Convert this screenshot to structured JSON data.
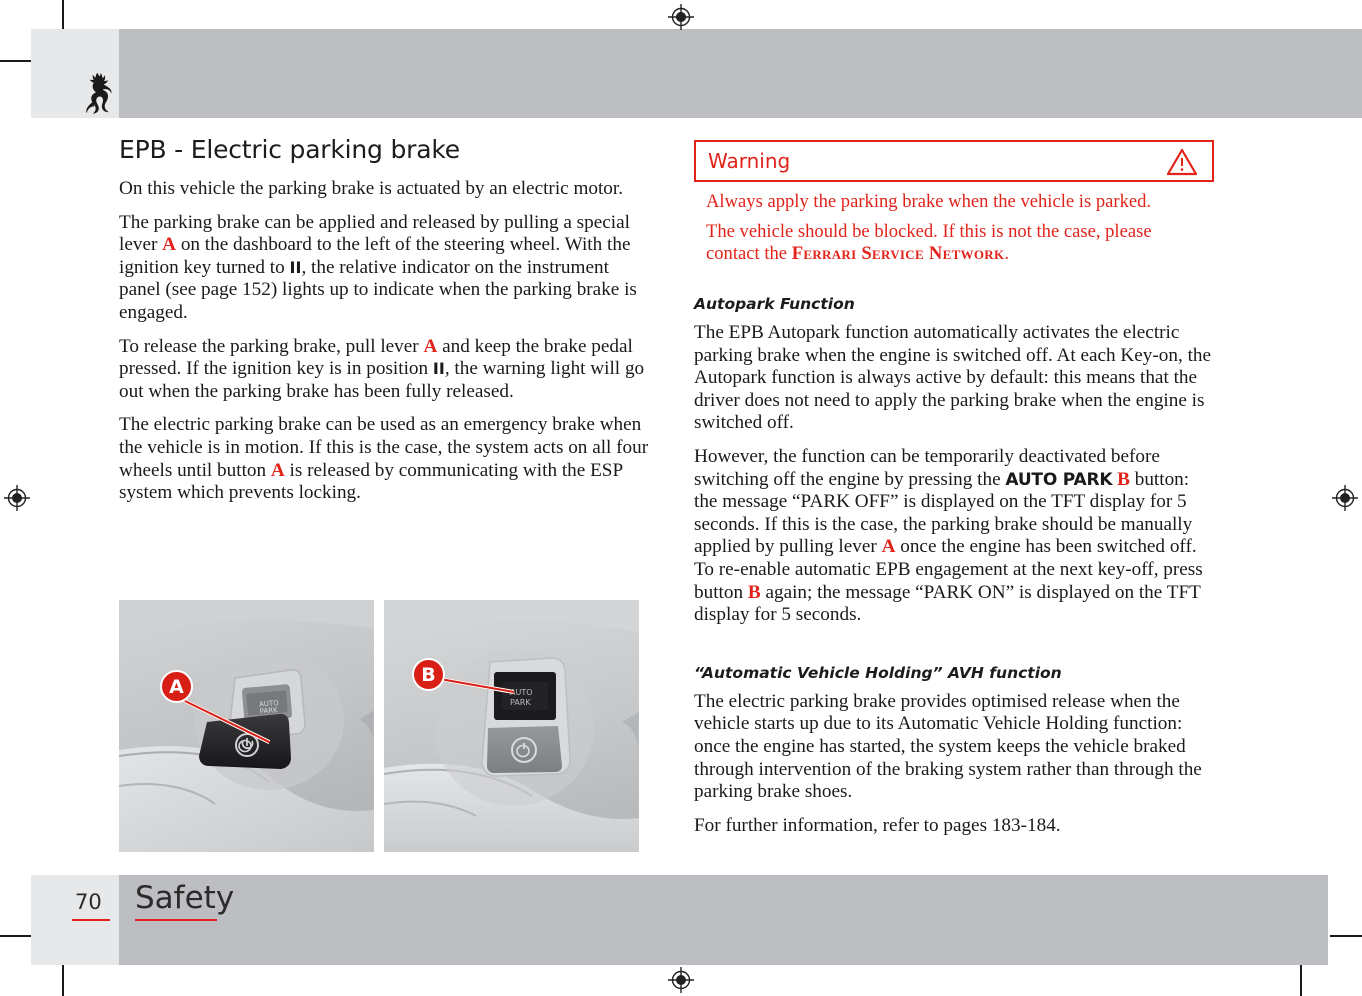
{
  "document": {
    "brand_mark": "ferrari-prancing-horse",
    "page_number": "70",
    "section_name": "Safety"
  },
  "left_column": {
    "title": "EPB - Electric parking brake",
    "paragraphs": [
      {
        "id": "p1",
        "runs": [
          {
            "t": "On this vehicle the parking brake is actuated by an electric motor.",
            "s": "n"
          }
        ]
      },
      {
        "id": "p2",
        "runs": [
          {
            "t": "The parking brake can be applied and released by pulling a special lever ",
            "s": "n"
          },
          {
            "t": "A",
            "s": "ref"
          },
          {
            "t": " on the dashboard to the left of the steering wheel. With the ignition key turned to ",
            "s": "n"
          },
          {
            "t": "II",
            "s": "key"
          },
          {
            "t": ", the relative indicator on the instrument panel (see page 152) lights up to indicate when the parking brake is engaged.",
            "s": "n"
          }
        ]
      },
      {
        "id": "p3",
        "runs": [
          {
            "t": "To release the parking brake, pull lever ",
            "s": "n"
          },
          {
            "t": "A",
            "s": "ref"
          },
          {
            "t": " and keep the brake pedal pressed. If the ignition key is in position ",
            "s": "n"
          },
          {
            "t": "II",
            "s": "key"
          },
          {
            "t": ", the warning light will go out when the parking brake has been fully released.",
            "s": "n"
          }
        ]
      },
      {
        "id": "p4",
        "runs": [
          {
            "t": "The electric parking brake can be used as an emergency brake when the vehicle is in motion. If this is the case, the system acts on all four wheels until button ",
            "s": "n"
          },
          {
            "t": "A",
            "s": "ref"
          },
          {
            "t": " is released by communicating with the ESP system which prevents locking.",
            "s": "n"
          }
        ]
      }
    ]
  },
  "warning": {
    "title": "Warning",
    "icon": "warning-triangle-icon",
    "lines": [
      {
        "id": "w1",
        "runs": [
          {
            "t": "Always apply the parking brake when the vehicle is parked.",
            "s": "n"
          }
        ]
      },
      {
        "id": "w2",
        "runs": [
          {
            "t": "The vehicle should be blocked. If this is not the case, please contact the ",
            "s": "n"
          },
          {
            "t": "Ferrari Service Network",
            "s": "smallcaps"
          },
          {
            "t": ".",
            "s": "n"
          }
        ]
      }
    ]
  },
  "right_column": {
    "sections": [
      {
        "id": "autopark",
        "heading": "Autopark Function",
        "paragraphs": [
          {
            "id": "ap1",
            "runs": [
              {
                "t": "The EPB Autopark function automatically activates the electric parking brake when the engine is switched off. At each Key-on, the Autopark function is always active by default: this means that the driver does not need to apply the parking brake when the engine is switched off.",
                "s": "n"
              }
            ]
          },
          {
            "id": "ap2",
            "runs": [
              {
                "t": "However, the function can be temporarily deactivated before switching off the engine by pressing the ",
                "s": "n"
              },
              {
                "t": "AUTO PARK",
                "s": "sansbold"
              },
              {
                "t": " ",
                "s": "n"
              },
              {
                "t": "B",
                "s": "ref"
              },
              {
                "t": " button: the message “PARK OFF” is displayed on the TFT display for 5 seconds. If this is the case, the parking brake should be manually applied by pulling lever ",
                "s": "n"
              },
              {
                "t": "A",
                "s": "ref"
              },
              {
                "t": " once the engine has been switched off. To re-enable automatic EPB engagement at the next key-off, press button ",
                "s": "n"
              },
              {
                "t": "B",
                "s": "ref"
              },
              {
                "t": " again; the message “PARK ON” is displayed on the TFT display for 5 seconds.",
                "s": "n"
              }
            ]
          }
        ]
      },
      {
        "id": "avh",
        "heading": "“Automatic Vehicle Holding” AVH function",
        "paragraphs": [
          {
            "id": "avh1",
            "runs": [
              {
                "t": "The electric parking brake provides optimised release when the vehicle starts up due to its Automatic Vehicle Holding function: once the engine has started, the system keeps the vehicle braked through intervention of the braking system rather than through the parking brake shoes.",
                "s": "n"
              }
            ]
          },
          {
            "id": "avh2",
            "runs": [
              {
                "t": "For further information, refer to pages 183-184.",
                "s": "n"
              }
            ]
          }
        ]
      }
    ]
  },
  "figures": [
    {
      "id": "photo-a",
      "caption_letter": "A",
      "description": "EPB lever on dashboard"
    },
    {
      "id": "photo-b",
      "caption_letter": "B",
      "description": "AUTO PARK button on dashboard"
    }
  ],
  "colors": {
    "accent_red": "#e2231a",
    "callout_red": "#d81f16",
    "band_light": "#e7e8ea",
    "band_gray": "#bcbec1",
    "text": "#1a1a1a"
  }
}
